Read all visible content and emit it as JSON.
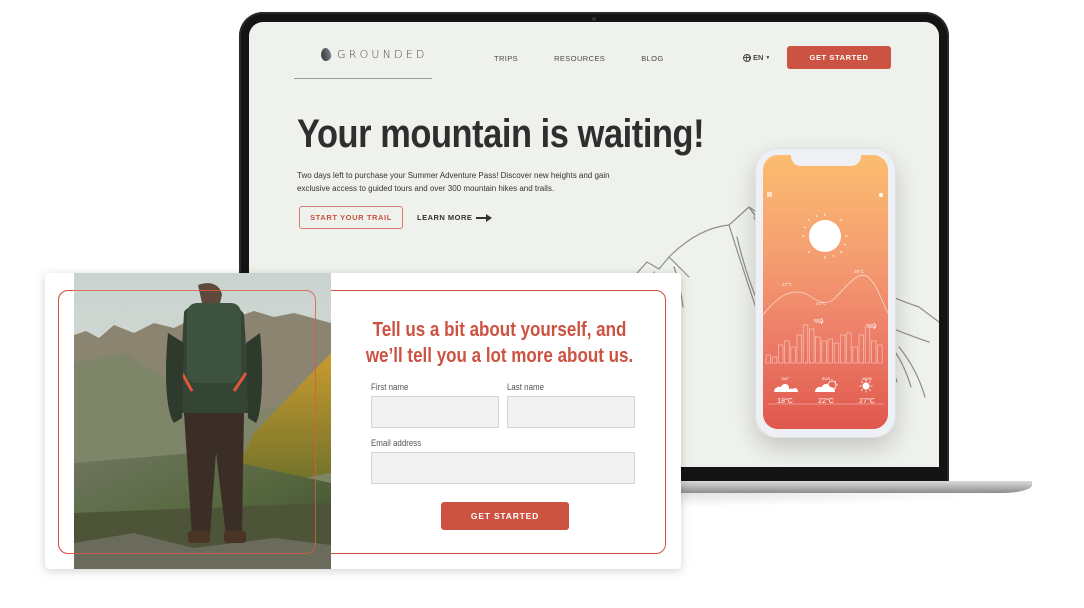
{
  "site": {
    "brand": "GROUNDED",
    "nav": [
      {
        "label": "TRIPS"
      },
      {
        "label": "RESOURCES"
      },
      {
        "label": "BLOG"
      }
    ],
    "language": "EN",
    "nav_cta": "GET STARTED",
    "hero": {
      "title": "Your mountain is waiting!",
      "body": "Two days left to purchase your Summer Adventure Pass! Discover new heights and gain exclusive access to guided tours and over 300 mountain hikes and trails.",
      "primary_button": "START YOUR TRAIL",
      "secondary_link": "LEARN MORE"
    }
  },
  "phone": {
    "curve_labels": [
      "27°C",
      "24°C",
      "29°C"
    ],
    "forecast": [
      {
        "day": "SAT",
        "icon": "cloud-icon",
        "temp": "18°C"
      },
      {
        "day": "SUN",
        "icon": "partly-sunny-icon",
        "temp": "22°C"
      },
      {
        "day": "MON",
        "icon": "sun-icon",
        "temp": "27°C"
      }
    ]
  },
  "form": {
    "title_line1": "Tell us a bit about yourself, and",
    "title_line2": "we’ll tell you a lot more about us.",
    "first_name_label": "First name",
    "first_name_value": "",
    "last_name_label": "Last name",
    "last_name_value": "",
    "email_label": "Email address",
    "email_value": "",
    "submit_label": "GET STARTED"
  },
  "colors": {
    "accent": "#cc5242",
    "screen_background": "#eff1ec",
    "phone_gradient_top": "#fbbc6f",
    "phone_gradient_bottom": "#e0574d"
  }
}
